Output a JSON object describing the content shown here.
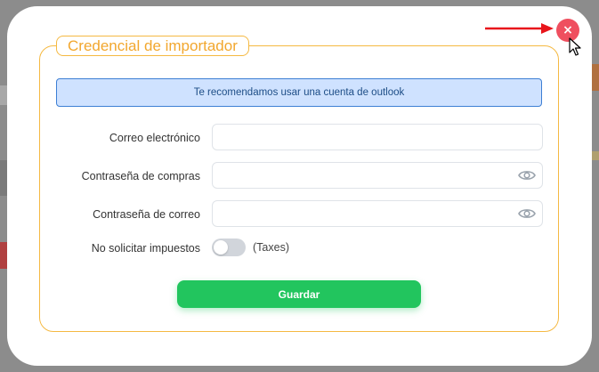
{
  "modal": {
    "legend_title": "Credencial de importador",
    "info_banner": "Te recomendamos usar una cuenta de outlook",
    "fields": [
      {
        "label": "Correo electrónico",
        "value": "",
        "type": "email"
      },
      {
        "label": "Contraseña de compras",
        "value": "",
        "type": "password",
        "icon": "eye-icon"
      },
      {
        "label": "Contraseña de correo",
        "value": "",
        "type": "password",
        "icon": "eye-icon"
      }
    ],
    "toggle": {
      "label": "No solicitar impuestos",
      "suffix": "(Taxes)",
      "on": false
    },
    "save_label": "Guardar",
    "close_glyph": "×"
  },
  "colors": {
    "accent_border": "#f5b942",
    "info_bg": "#cfe2ff",
    "save_button": "#22c55e",
    "close_button": "#ef4f5f"
  }
}
